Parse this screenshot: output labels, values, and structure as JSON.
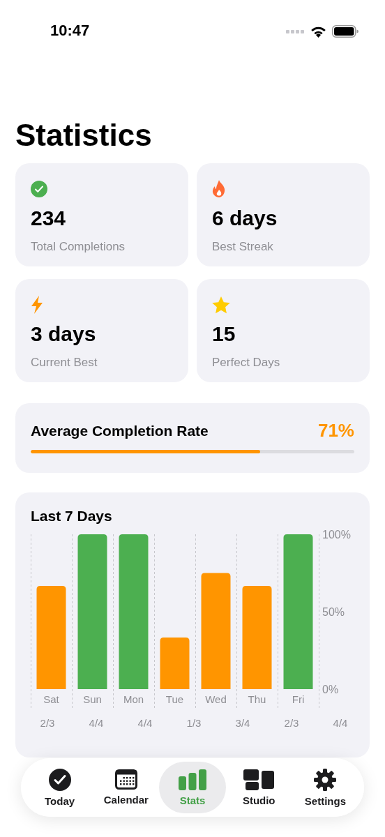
{
  "status_bar": {
    "time": "10:47"
  },
  "title": "Statistics",
  "stat_cards": [
    {
      "kind": "check",
      "value": "234",
      "label": "Total Completions"
    },
    {
      "kind": "flame",
      "value": "6 days",
      "label": "Best Streak"
    },
    {
      "kind": "bolt",
      "value": "3 days",
      "label": "Current Best"
    },
    {
      "kind": "star",
      "value": "15",
      "label": "Perfect Days"
    }
  ],
  "completion_rate": {
    "label": "Average Completion Rate",
    "reading": "71%",
    "level": 0.71
  },
  "last_7_days": {
    "title": "Last 7 Days",
    "chart_data": {
      "type": "bar",
      "categories": [
        "Sat",
        "Sun",
        "Mon",
        "Tue",
        "Wed",
        "Thu",
        "Fri"
      ],
      "series": [
        {
          "color": "#4caf50",
          "values": [
            null,
            100,
            100,
            null,
            null,
            null,
            100
          ]
        },
        {
          "color": "#ff9500",
          "values": [
            66.7,
            null,
            null,
            33.3,
            75,
            66.7,
            null
          ]
        }
      ],
      "stacked": true,
      "ylim": [
        0,
        100
      ],
      "yticks": [
        {
          "value": 0,
          "label": "0%"
        },
        {
          "value": 50,
          "label": "50%"
        },
        {
          "value": 100,
          "label": "100%"
        }
      ],
      "value_labels": [
        "2/3",
        "4/4",
        "4/4",
        "1/3",
        "3/4",
        "2/3",
        "4/4"
      ]
    }
  },
  "tab_bar": [
    {
      "kind": "today",
      "label": "Today",
      "selected": false
    },
    {
      "kind": "calendar",
      "label": "Calendar",
      "selected": false
    },
    {
      "kind": "stats",
      "label": "Stats",
      "selected": true
    },
    {
      "kind": "studio",
      "label": "Studio",
      "selected": false
    },
    {
      "kind": "settings",
      "label": "Settings",
      "selected": false
    }
  ]
}
